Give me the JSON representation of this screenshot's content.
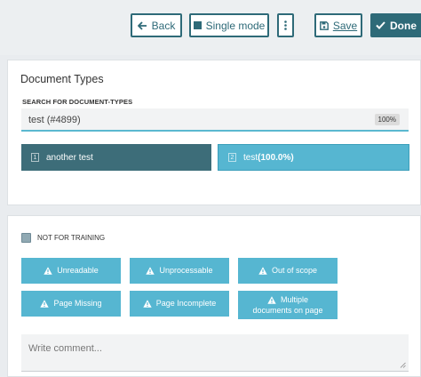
{
  "toolbar": {
    "back": {
      "label": "Back",
      "icon": "arrow-left-icon"
    },
    "single_mode": {
      "label": "Single mode",
      "icon": "square-icon"
    },
    "more": {
      "icon": "vertical-dots-icon"
    },
    "save": {
      "label": "Save",
      "icon": "floppy-disk-icon"
    },
    "done": {
      "label": "Done",
      "icon": "checkmark-icon"
    }
  },
  "document_types": {
    "title": "Document Types",
    "search_label": "SEARCH FOR DOCUMENT-TYPES",
    "search_value": "test (#4899)",
    "match_percent": "100%",
    "results": [
      {
        "index": "1",
        "label": "another test",
        "selected": false
      },
      {
        "index": "2",
        "label": "test",
        "score": "(100.0%)",
        "selected": true
      }
    ]
  },
  "flags": {
    "not_for_training": {
      "label": "NOT FOR TRAINING",
      "checked": false
    },
    "tags": [
      {
        "label": "Unreadable",
        "icon": "warning-icon"
      },
      {
        "label": "Unprocessable",
        "icon": "warning-icon"
      },
      {
        "label": "Out of scope",
        "icon": "warning-icon"
      },
      {
        "label": "Page Missing",
        "icon": "warning-icon"
      },
      {
        "label": "Page Incomplete",
        "icon": "warning-icon"
      },
      {
        "label_line1": "Multiple",
        "label_line2": "documents on page",
        "icon": "warning-icon"
      }
    ],
    "comment_placeholder": "Write comment..."
  },
  "colors": {
    "primary_dark": "#2e6a78",
    "accent": "#56b6d1",
    "result_unselected": "#3d6d79"
  }
}
